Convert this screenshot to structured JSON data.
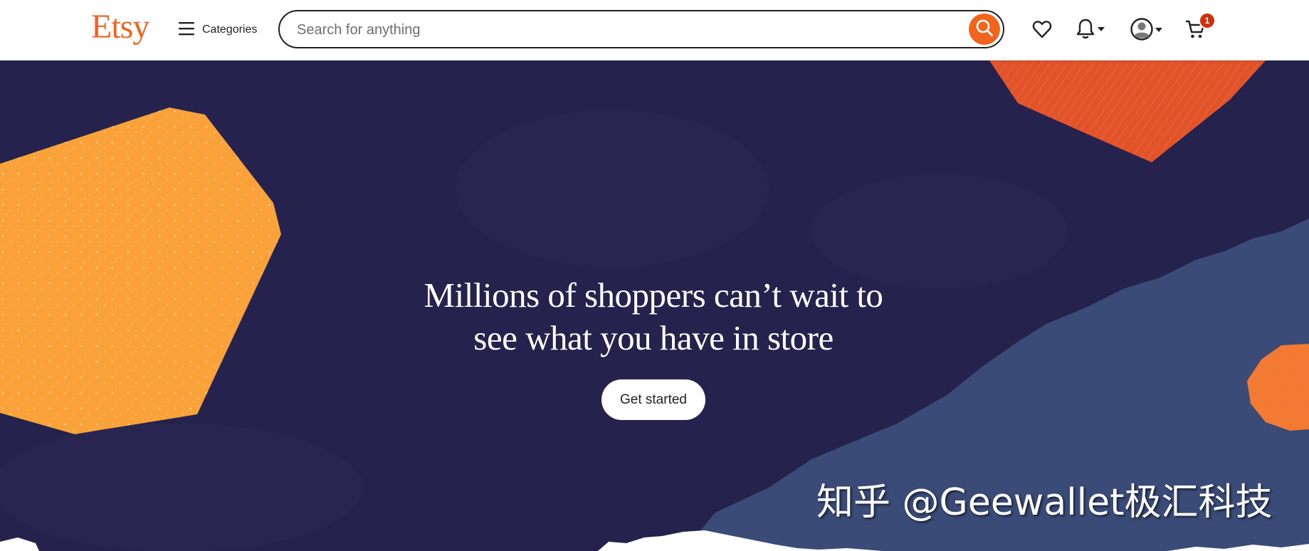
{
  "header": {
    "logo": "Etsy",
    "categories_label": "Categories",
    "search": {
      "placeholder": "Search for anything"
    },
    "cart_count": "1",
    "icons": [
      "menu-icon",
      "search-icon",
      "heart-icon",
      "bell-icon",
      "user-icon",
      "cart-icon"
    ]
  },
  "hero": {
    "headline_line1": "Millions of shoppers can’t wait to",
    "headline_line2": "see what you have in store",
    "cta_label": "Get started"
  },
  "watermark": "知乎 @Geewallet极汇科技",
  "colors": {
    "brand": "#F1641E",
    "hero_bg": "#25234D",
    "yellow_shape": "#F9A23A",
    "red_shape": "#E2532A",
    "blue_shape": "#3A4B78",
    "badge": "#D1300D"
  }
}
